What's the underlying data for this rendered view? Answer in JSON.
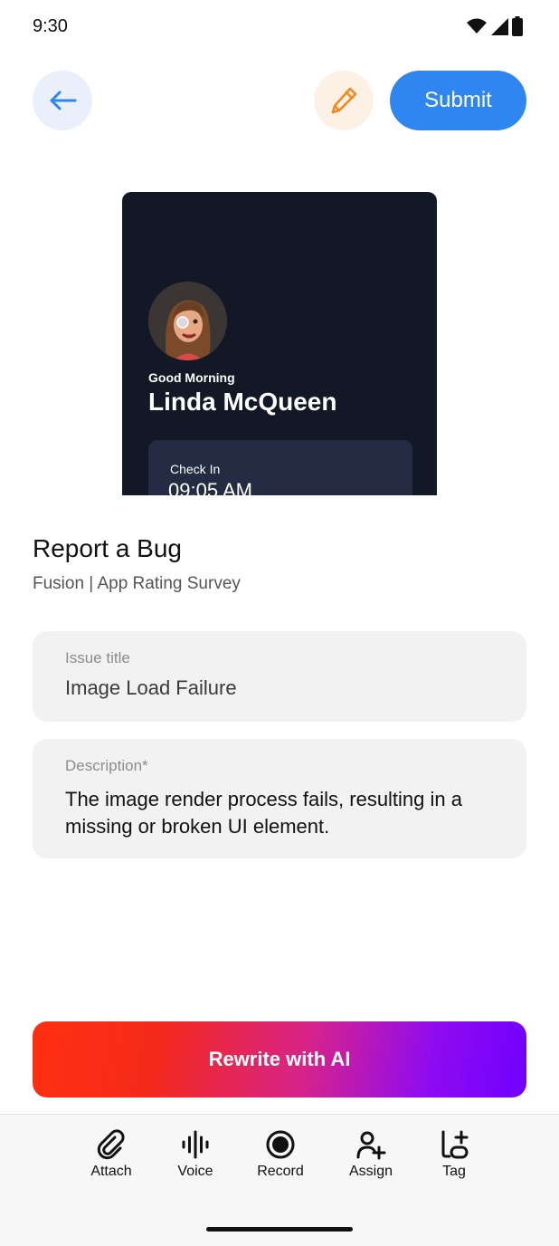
{
  "status_bar": {
    "time": "9:30"
  },
  "header": {
    "submit_label": "Submit"
  },
  "preview": {
    "greeting": "Good Morning",
    "name": "Linda McQueen",
    "checkin_label": "Check In",
    "checkin_time": "09:05 AM"
  },
  "report": {
    "title": "Report a Bug",
    "subtitle": "Fusion | App Rating Survey"
  },
  "fields": {
    "issue": {
      "label": "Issue title",
      "value": "Image Load Failure"
    },
    "description": {
      "label": "Description*",
      "value": "The image render process fails, resulting in a missing or broken UI element."
    }
  },
  "ai_button": {
    "label": "Rewrite with AI"
  },
  "toolbar": {
    "items": [
      {
        "label": "Attach",
        "icon": "paperclip-icon"
      },
      {
        "label": "Voice",
        "icon": "waveform-icon"
      },
      {
        "label": "Record",
        "icon": "record-icon"
      },
      {
        "label": "Assign",
        "icon": "user-add-icon"
      },
      {
        "label": "Tag",
        "icon": "tag-icon"
      }
    ]
  },
  "colors": {
    "accent": "#2f86f0",
    "edit": "#f08a1c",
    "preview_bg": "#121826",
    "field_bg": "#f2f2f2",
    "ai_gradient_start": "#ff2f10",
    "ai_gradient_end": "#7000ff"
  }
}
